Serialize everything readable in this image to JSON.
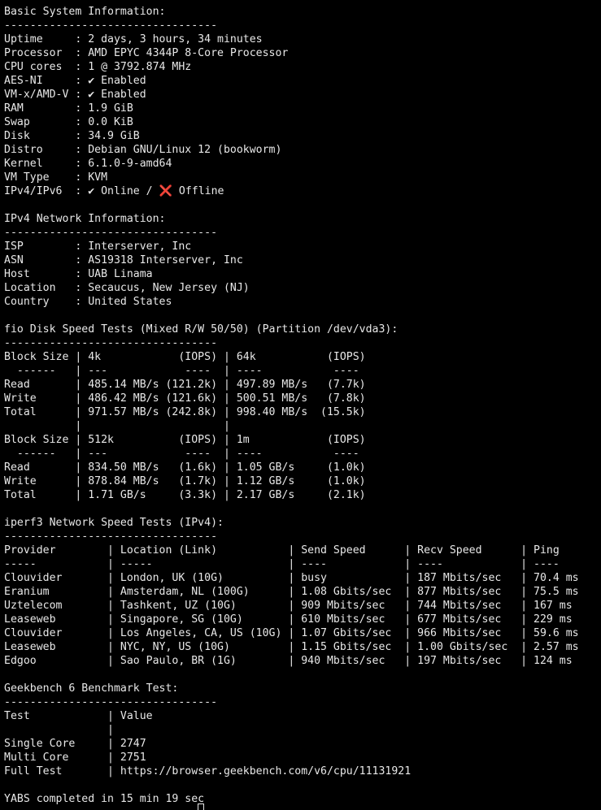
{
  "terminal": {
    "lines": [
      "Basic System Information:",
      "---------------------------------",
      "Uptime     : 2 days, 3 hours, 34 minutes",
      "Processor  : AMD EPYC 4344P 8-Core Processor",
      "CPU cores  : 1 @ 3792.874 MHz",
      "AES-NI     : ✔ Enabled",
      "VM-x/AMD-V : ✔ Enabled",
      "RAM        : 1.9 GiB",
      "Swap       : 0.0 KiB",
      "Disk       : 34.9 GiB",
      "Distro     : Debian GNU/Linux 12 (bookworm)",
      "Kernel     : 6.1.0-9-amd64",
      "VM Type    : KVM",
      "",
      "",
      "IPv4 Network Information:",
      "---------------------------------",
      "ISP        : Interserver, Inc",
      "ASN        : AS19318 Interserver, Inc",
      "Host       : UAB Linama",
      "Location   : Secaucus, New Jersey (NJ)",
      "Country    : United States",
      "",
      "fio Disk Speed Tests (Mixed R/W 50/50) (Partition /dev/vda3):",
      "---------------------------------",
      "Block Size | 4k            (IOPS) | 64k           (IOPS)",
      "  ------   | ---            ----  | ----           ----",
      "Read       | 485.14 MB/s (121.2k) | 497.89 MB/s   (7.7k)",
      "Write      | 486.42 MB/s (121.6k) | 500.51 MB/s   (7.8k)",
      "Total      | 971.57 MB/s (242.8k) | 998.40 MB/s  (15.5k)",
      "           |                      |",
      "Block Size | 512k          (IOPS) | 1m            (IOPS)",
      "  ------   | ---            ----  | ----           ----",
      "Read       | 834.50 MB/s   (1.6k) | 1.05 GB/s     (1.0k)",
      "Write      | 878.84 MB/s   (1.7k) | 1.12 GB/s     (1.0k)",
      "Total      | 1.71 GB/s     (3.3k) | 2.17 GB/s     (2.1k)",
      "",
      "iperf3 Network Speed Tests (IPv4):",
      "---------------------------------",
      "Provider        | Location (Link)           | Send Speed      | Recv Speed      | Ping",
      "-----           | -----                     | ----            | ----            | ----",
      "Clouvider       | London, UK (10G)          | busy            | 187 Mbits/sec   | 70.4 ms",
      "Eranium         | Amsterdam, NL (100G)      | 1.08 Gbits/sec  | 877 Mbits/sec   | 75.5 ms",
      "Uztelecom       | Tashkent, UZ (10G)        | 909 Mbits/sec   | 744 Mbits/sec   | 167 ms",
      "Leaseweb        | Singapore, SG (10G)       | 610 Mbits/sec   | 677 Mbits/sec   | 229 ms",
      "Clouvider       | Los Angeles, CA, US (10G) | 1.07 Gbits/sec  | 966 Mbits/sec   | 59.6 ms",
      "Leaseweb        | NYC, NY, US (10G)         | 1.15 Gbits/sec  | 1.00 Gbits/sec  | 2.57 ms",
      "Edgoo           | Sao Paulo, BR (1G)        | 940 Mbits/sec   | 197 Mbits/sec   | 124 ms",
      "",
      "Geekbench 6 Benchmark Test:",
      "---------------------------------",
      "Test            | Value",
      "                |",
      "Single Core     | 2747",
      "Multi Core      | 2751",
      "Full Test       | https://browser.geekbench.com/v6/cpu/11131921",
      "",
      "YABS completed in 15 min 19 sec"
    ],
    "ipv6_line": {
      "prefix": "IPv4/IPv6  : ✔ Online / ",
      "cross": "❌",
      "suffix": " Offline"
    }
  }
}
